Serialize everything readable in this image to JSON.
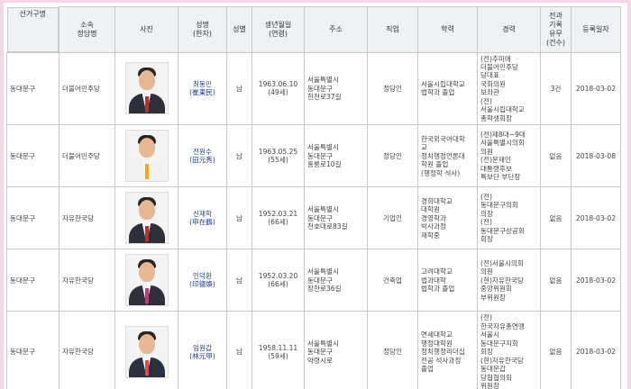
{
  "headers": {
    "district": "선거구명",
    "party": "소속\n정당명",
    "photo": "사진",
    "name": "성명\n(한자)",
    "gender": "성별",
    "birth": "생년월일\n(연령)",
    "addr": "주소",
    "job": "직업",
    "edu": "학력",
    "career": "경력",
    "crim": "전과\n기록\n유무\n(건수)",
    "reg": "등록일자"
  },
  "rows": [
    {
      "district": "동대문구",
      "party": "더불어민주당",
      "photo_icon": "candidate-photo",
      "name_ko": "최동민",
      "name_hj": "(崔東民)",
      "gender": "남",
      "birth": "1963.06.10\n(49세)",
      "addr": "서울특별시\n동대문구\n한천로37길",
      "job": "정당인",
      "edu": "서울시립대학교\n법학과 졸업",
      "career": "(전)추미애\n더불어민주당\n당대표\n국회의원\n보좌관\n(전)\n서울시립대학교\n총학생회장",
      "crim": "3건",
      "reg": "2018-03-02"
    },
    {
      "district": "동대문구",
      "party": "더불어민주당",
      "photo_icon": "candidate-photo",
      "name_ko": "전원수",
      "name_hj": "(田元秀)",
      "gender": "남",
      "birth": "1963.05.25\n(55세)",
      "addr": "서울특별시\n동대문구\n홍릉로10길",
      "job": "정당인",
      "edu": "한국외국어대학\n교\n정치행정언론대\n학원 졸업\n(행정학 석사)",
      "career": "(전)제8대~9대\n서울특별시의회\n의원\n(전)문재인\n대통령후보\n특보단 부단장",
      "crim": "없음",
      "reg": "2018-03-08"
    },
    {
      "district": "동대문구",
      "party": "자유한국당",
      "photo_icon": "candidate-photo",
      "name_ko": "신재학",
      "name_hj": "(申在鶴)",
      "gender": "남",
      "birth": "1952.03.21\n(66세)",
      "addr": "서울특별시\n동대문구\n천호대로83길",
      "job": "기업인",
      "edu": "경희대학교\n대학원\n경영학과\n박사과정\n재학중",
      "career": "(전)\n동대문구의회\n의장\n(전)\n동대문구상공회\n회장",
      "crim": "없음",
      "reg": "2018-03-02"
    },
    {
      "district": "동대문구",
      "party": "자유한국당",
      "photo_icon": "candidate-photo",
      "name_ko": "인덕환",
      "name_hj": "(印德煥)",
      "gender": "남",
      "birth": "1952.03.20\n(66세)",
      "addr": "서울특별시\n동대문구\n장한로36길",
      "job": "건축업",
      "edu": "고려대학교\n법과대학\n법학과 졸업",
      "career": "(전)서울시의회\n의원\n(현)자유한국당\n중앙위원회\n부위원장",
      "crim": "없음",
      "reg": "2018-03-02"
    },
    {
      "district": "동대문구",
      "party": "자유한국당",
      "photo_icon": "candidate-photo",
      "name_ko": "임원갑",
      "name_hj": "(林元甲)",
      "gender": "남",
      "birth": "1958.11.11\n(59세)",
      "addr": "서울특별시\n동대문구\n약령시로",
      "job": "정당인",
      "edu": "연세대학교\n행정대학원\n정치행정리더십\n전공 석사과정\n졸업",
      "career": "(전)\n한국자유총연맹\n서울시\n동대문구지회\n회장\n(현)자유한국당\n동대문갑\n당협협의회\n위원장",
      "crim": "없음",
      "reg": "2018-03-02"
    }
  ]
}
